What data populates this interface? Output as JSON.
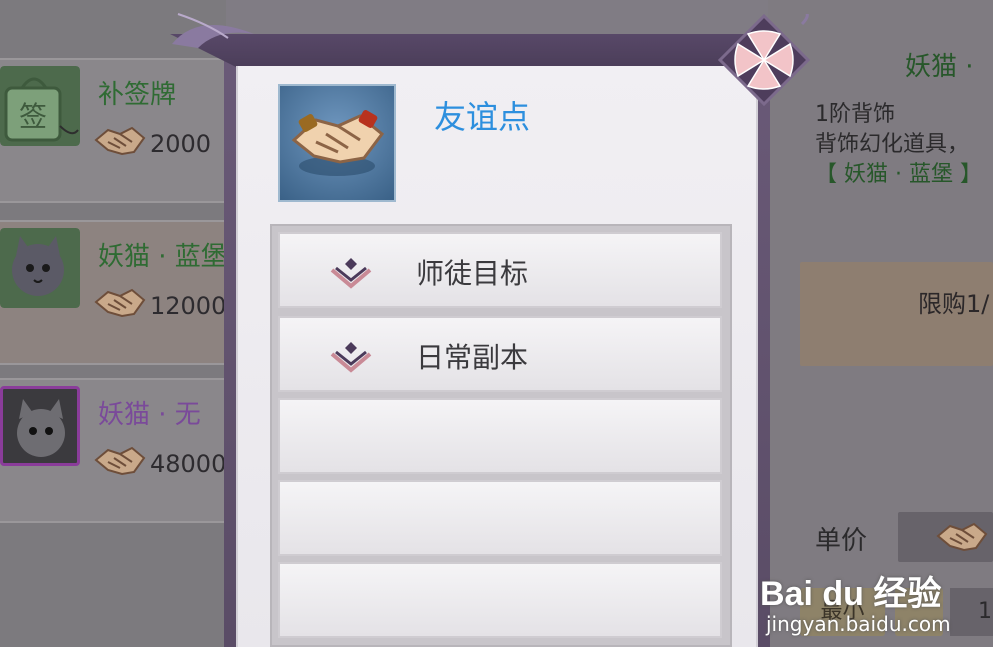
{
  "shop": {
    "items": [
      {
        "name": "补签牌",
        "price": "2000",
        "name_color": "#2f6b33"
      },
      {
        "name": "妖猫 · 蓝堡",
        "price": "12000",
        "name_color": "#2f6b33"
      },
      {
        "name": "妖猫 · 无",
        "price": "48000",
        "name_color": "#7a4a9a"
      }
    ],
    "detail": {
      "title": "妖猫 ·",
      "line1": "1阶背饰",
      "line2": "背饰幻化道具，",
      "line3": "【 妖猫 · 蓝堡 】"
    },
    "limit_text": "限购1/",
    "unit_price_label": "单价",
    "min_button": "最小",
    "quantity": "1"
  },
  "popup": {
    "title": "友谊点",
    "icon": "handshake-icon",
    "sources": [
      {
        "label": "师徒目标",
        "icon": "diamond-chevron-icon"
      },
      {
        "label": "日常副本",
        "icon": "diamond-chevron-icon"
      },
      {
        "label": ""
      },
      {
        "label": ""
      },
      {
        "label": ""
      }
    ],
    "close_icon": "close-x-icon"
  },
  "watermark": {
    "logo": "Bai du 经验",
    "url": "jingyan.baidu.com"
  },
  "colors": {
    "popup_title": "#2d8fde",
    "panel_frame": "#5a4c66",
    "close_accent": "#f2c4c8"
  }
}
